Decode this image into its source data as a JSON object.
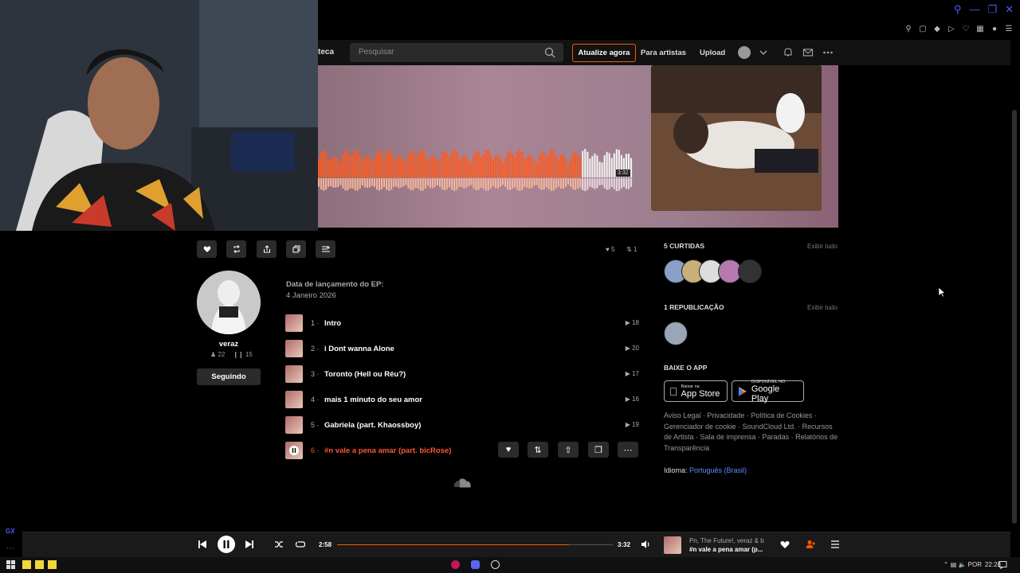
{
  "header": {
    "nav_library": "teca",
    "search_placeholder": "Pesquisar",
    "upgrade_label": "Atualize agora",
    "for_artists_label": "Para artistas",
    "upload_label": "Upload"
  },
  "hero": {
    "duration_tag": "3:32"
  },
  "actions": {
    "likes_count": "5",
    "reposts_count": "1"
  },
  "artist": {
    "name": "veraz",
    "followers": "22",
    "tracks": "15",
    "follow_label": "Seguindo"
  },
  "release": {
    "label": "Data de lançamento do EP:",
    "date": "4 Janeiro 2026"
  },
  "tracks": [
    {
      "num": "1",
      "title": "Intro",
      "plays": "18"
    },
    {
      "num": "2",
      "title": "i Dont wanna Alone",
      "plays": "20"
    },
    {
      "num": "3",
      "title": "Toronto (Hell ou Réu?)",
      "plays": "17"
    },
    {
      "num": "4",
      "title": "mais 1 minuto do seu amor",
      "plays": "16"
    },
    {
      "num": "5",
      "title": "Gabriela (part. Khaossboy)",
      "plays": "19"
    },
    {
      "num": "6",
      "title": "#n vale a pena amar (part. bicRose)",
      "plays": ""
    }
  ],
  "sidebar": {
    "likes_heading": "5 CURTIDAS",
    "likes_more": "Exibir tudo",
    "reposts_heading": "1 REPUBLICAÇÃO",
    "reposts_more": "Exibir tudo",
    "app_heading": "BAIXE O APP",
    "appstore_small": "Baixar na",
    "appstore_big": "App Store",
    "googleplay_small": "DISPONÍVEL NO",
    "googleplay_big": "Google Play",
    "footer_links": "Aviso Legal · Privacidade · Política de Cookies · Gerenciador de cookie · SoundCloud Ltd. · Recursos de Artista · Sala de imprensa · Paradas · Relatórios de Transparência",
    "language_label": "Idioma:",
    "language_value": "Português (Brasil)"
  },
  "player": {
    "current_time": "2:58",
    "total_time": "3:32",
    "progress": 0.84,
    "now_artist": "Pn, The Future!, veraz & b",
    "now_title": "#n vale a pena amar (p..."
  },
  "taskbar": {
    "language": "POR",
    "clock": "22:28"
  },
  "side": {
    "gx_label": "GX"
  },
  "colors": {
    "accent": "#ff5500",
    "active_track": "#ff5533",
    "link": "#5c8cff"
  }
}
